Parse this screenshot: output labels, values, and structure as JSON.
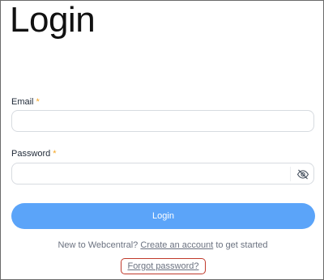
{
  "page": {
    "title": "Login"
  },
  "form": {
    "email": {
      "label": "Email",
      "required_marker": "*",
      "value": "",
      "placeholder": ""
    },
    "password": {
      "label": "Password",
      "required_marker": "*",
      "value": "",
      "placeholder": "",
      "toggle_icon": "eye-off-icon"
    },
    "submit_label": "Login",
    "colors": {
      "submit_bg": "#5ba4f9",
      "required": "#f5a623",
      "highlight_border": "#c0392b"
    }
  },
  "signup": {
    "prefix": "New to Webcentral?",
    "link": "Create an account",
    "suffix": "to get started"
  },
  "forgot": {
    "link": "Forgot password?"
  }
}
